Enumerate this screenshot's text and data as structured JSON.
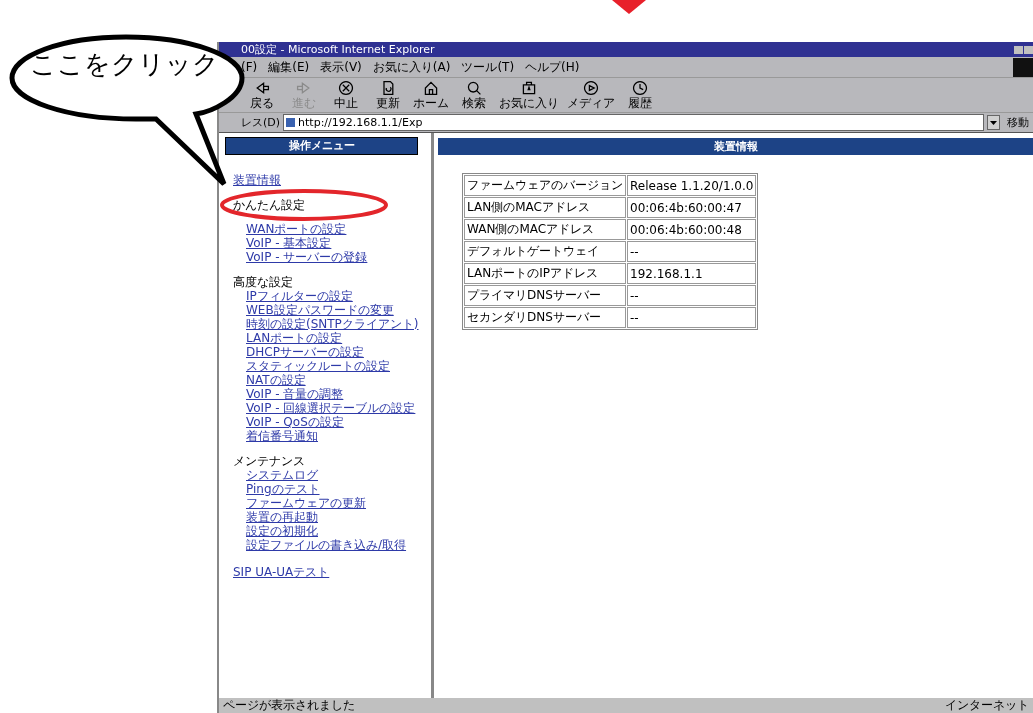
{
  "callout": {
    "text": "ここをクリック"
  },
  "window": {
    "title": "00設定 - Microsoft Internet Explorer"
  },
  "menu_bar": [
    "(F)",
    "編集(E)",
    "表示(V)",
    "お気に入り(A)",
    "ツール(T)",
    "ヘルプ(H)"
  ],
  "toolbar": [
    {
      "kind": "back",
      "label": "戻る",
      "disabled": false
    },
    {
      "kind": "forward",
      "label": "進む",
      "disabled": true
    },
    {
      "kind": "stop",
      "label": "中止",
      "disabled": false
    },
    {
      "kind": "refresh",
      "label": "更新",
      "disabled": false
    },
    {
      "kind": "home",
      "label": "ホーム",
      "disabled": false
    },
    {
      "kind": "search",
      "label": "検索",
      "disabled": false
    },
    {
      "kind": "favorites",
      "label": "お気に入り",
      "disabled": false
    },
    {
      "kind": "media",
      "label": "メディア",
      "disabled": false
    },
    {
      "kind": "history",
      "label": "履歴",
      "disabled": false
    }
  ],
  "address_bar": {
    "label": "レス(D)",
    "value": "http://192.168.1.1/Exp",
    "go": "移動"
  },
  "side_menu": {
    "title": "操作メニュー",
    "top_link": "装置情報",
    "sections": [
      {
        "heading": "かんたん設定",
        "highlighted": true,
        "links": [
          "WANポートの設定",
          "VoIP - 基本設定",
          "VoIP - サーバーの登録"
        ]
      },
      {
        "heading": "高度な設定",
        "highlighted": false,
        "links": [
          "IPフィルターの設定",
          "WEB設定パスワードの変更",
          "時刻の設定(SNTPクライアント)",
          "LANポートの設定",
          "DHCPサーバーの設定",
          "スタティックルートの設定",
          "NATの設定",
          "VoIP - 音量の調整",
          "VoIP - 回線選択テーブルの設定",
          "VoIP - QoSの設定",
          "着信番号通知"
        ]
      },
      {
        "heading": "メンテナンス",
        "highlighted": false,
        "links": [
          "システムログ",
          "Pingのテスト",
          "ファームウェアの更新",
          "装置の再起動",
          "設定の初期化",
          "設定ファイルの書き込み/取得"
        ]
      }
    ],
    "bottom_link": "SIP UA-UAテスト"
  },
  "main": {
    "title": "装置情報",
    "table": [
      {
        "label": "ファームウェアのバージョン",
        "value": "Release 1.1.20/1.0.0"
      },
      {
        "label": "LAN側のMACアドレス",
        "value": "00:06:4b:60:00:47"
      },
      {
        "label": "WAN側のMACアドレス",
        "value": "00:06:4b:60:00:48"
      },
      {
        "label": "デフォルトゲートウェイ",
        "value": "--"
      },
      {
        "label": "LANポートのIPアドレス",
        "value": "192.168.1.1"
      },
      {
        "label": "プライマリDNSサーバー",
        "value": "--"
      },
      {
        "label": "セカンダリDNSサーバー",
        "value": "--"
      }
    ]
  },
  "status_bar": {
    "message": "ページが表示されました",
    "zone": "インターネット"
  }
}
